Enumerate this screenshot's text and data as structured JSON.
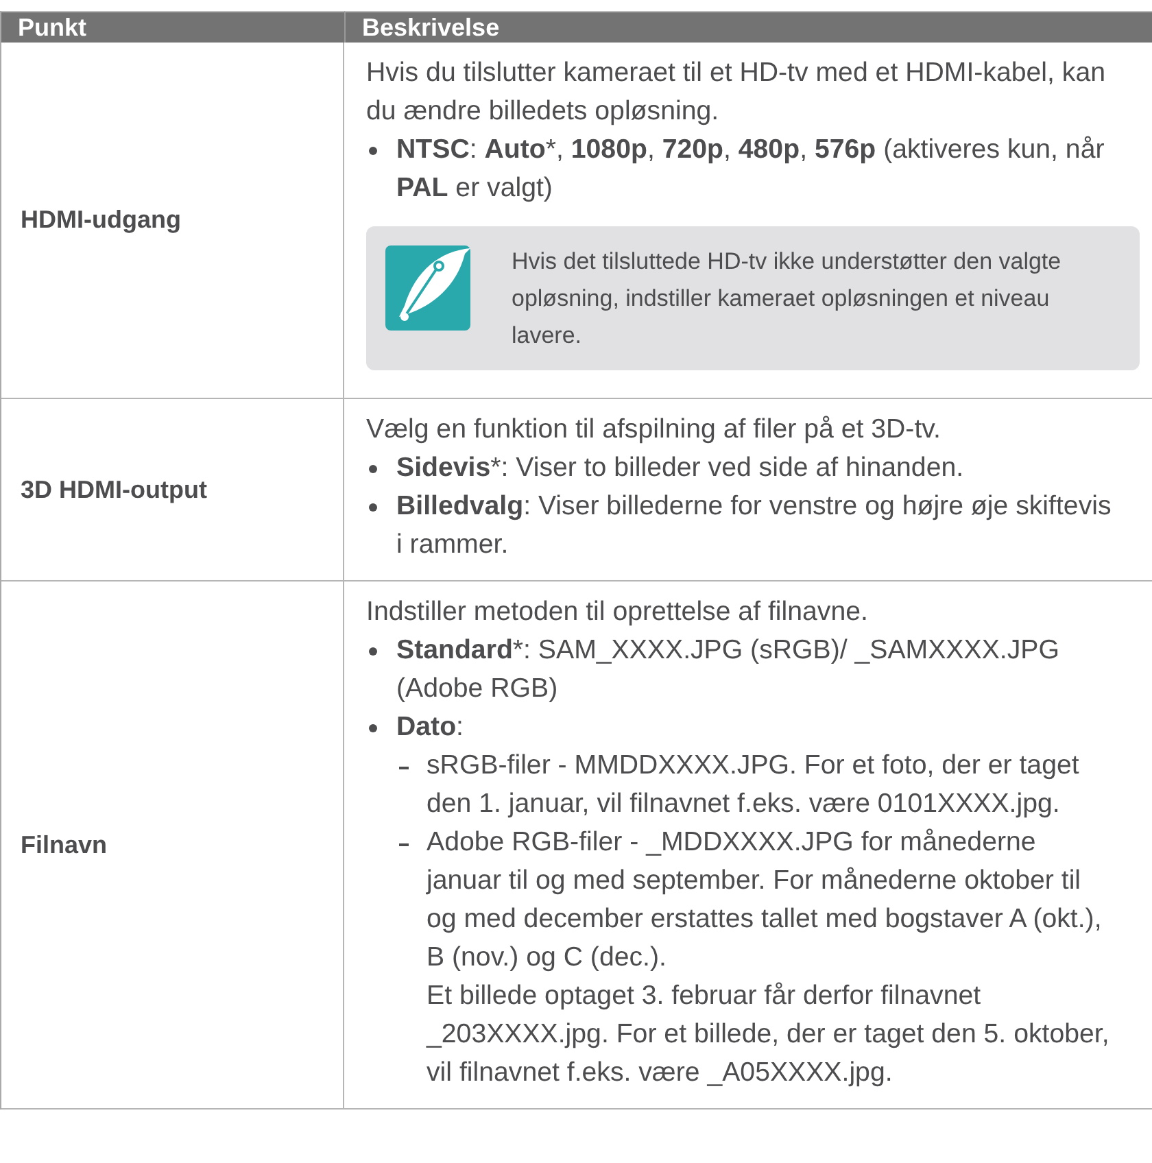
{
  "table": {
    "columns": [
      "Punkt",
      "Beskrivelse"
    ],
    "rows": [
      {
        "item": "HDMI-udgang",
        "blocks": [
          {
            "kind": "text",
            "text": "Hvis du tilslutter kameraet til et HD-tv med et HDMI-kabel, kan du ændre billedets opløsning."
          },
          {
            "kind": "bullet",
            "text": "**NTSC**: **Auto***, **1080p**, **720p**, **480p**, **576p** (aktiveres kun, når **PAL** er valgt)"
          },
          {
            "kind": "note",
            "text": "Hvis det tilsluttede HD-tv ikke understøtter den valgte opløsning, indstiller kameraet opløsningen et niveau lavere."
          }
        ]
      },
      {
        "item": "3D HDMI-output",
        "blocks": [
          {
            "kind": "text",
            "text": "Vælg en funktion til afspilning af filer på et 3D-tv."
          },
          {
            "kind": "bullet",
            "text": "**Sidevis***: Viser to billeder ved side af hinanden."
          },
          {
            "kind": "bullet",
            "text": "**Billedvalg**: Viser billederne for venstre og højre øje skiftevis i rammer."
          }
        ]
      },
      {
        "item": "Filnavn",
        "blocks": [
          {
            "kind": "text",
            "text": "Indstiller metoden til oprettelse af filnavne."
          },
          {
            "kind": "bullet",
            "text": "**Standard***: SAM_XXXX.JPG (sRGB)/ _SAMXXXX.JPG (Adobe RGB)"
          },
          {
            "kind": "bullet",
            "text": "**Dato**:",
            "children": [
              {
                "kind": "dash",
                "text": "sRGB-filer - MMDDXXXX.JPG. For et foto, der er taget den 1. januar, vil filnavnet f.eks. være 0101XXXX.jpg."
              },
              {
                "kind": "dash",
                "text": "Adobe RGB-filer - _MDDXXXX.JPG for månederne januar til og med september. For månederne oktober til og med december erstattes tallet med bogstaver A (okt.), B (nov.) og C (dec.).\nEt billede optaget 3. februar får derfor filnavnet _203XXXX.jpg. For et billede, der er taget den 5. oktober, vil filnavnet f.eks. være _A05XXXX.jpg."
              }
            ]
          }
        ]
      }
    ]
  }
}
